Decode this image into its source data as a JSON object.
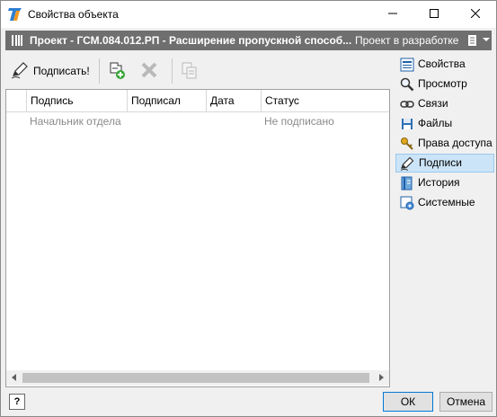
{
  "window": {
    "title": "Свойства объекта",
    "app_icon": "t-flex-logo-icon",
    "controls": [
      "minimize-icon",
      "maximize-icon",
      "close-icon"
    ]
  },
  "object_bar": {
    "title": "Проект - ГСМ.084.012.РП - Расширение пропускной способ...",
    "state": "Проект в разработке",
    "book_icon": "book-icon",
    "menu_icon": "document-menu-icon"
  },
  "toolbar": {
    "sign_label": "Подписать!",
    "sign_icon": "pen-sign-icon",
    "add_icon": "add-signature-icon",
    "delete_icon": "delete-x-icon",
    "copy_icon": "copy-disabled-icon"
  },
  "table": {
    "columns": [
      "Подпись",
      "Подписал",
      "Дата",
      "Статус"
    ],
    "rows": [
      {
        "signature": "Начальник отдела",
        "signed_by": "",
        "date": "",
        "status": "Не подписано"
      }
    ]
  },
  "nav": {
    "items": [
      {
        "label": "Свойства",
        "icon": "properties-icon"
      },
      {
        "label": "Просмотр",
        "icon": "magnifier-icon"
      },
      {
        "label": "Связи",
        "icon": "chain-link-icon"
      },
      {
        "label": "Файлы",
        "icon": "files-icon"
      },
      {
        "label": "Права доступа",
        "icon": "keys-icon"
      },
      {
        "label": "Подписи",
        "icon": "pen-icon"
      },
      {
        "label": "История",
        "icon": "history-book-icon"
      },
      {
        "label": "Системные",
        "icon": "system-gear-icon"
      }
    ],
    "selected": "Подписи"
  },
  "footer": {
    "help_label": "?",
    "ok_label": "ОК",
    "cancel_label": "Отмена"
  },
  "colors": {
    "object_bar_bg": "#6f6f6f",
    "selected_nav_bg": "#cce4f7",
    "ok_border": "#0078d7"
  }
}
